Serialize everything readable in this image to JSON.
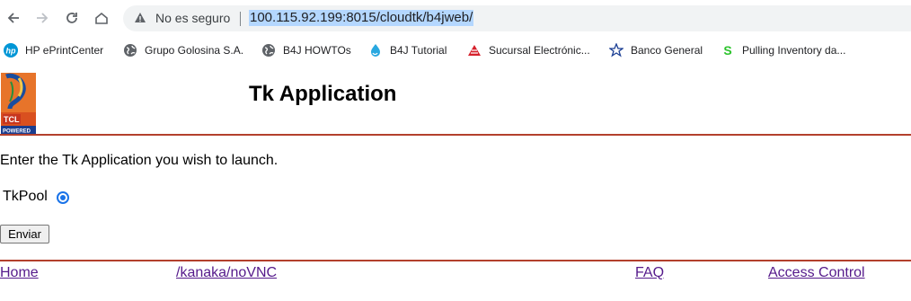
{
  "browser": {
    "security_label": "No es seguro",
    "url": "100.115.92.199:8015/cloudtk/b4jweb/"
  },
  "bookmarks": [
    {
      "label": "HP ePrintCenter",
      "icon": "hp-icon"
    },
    {
      "label": "Grupo Golosina S.A.",
      "icon": "globe-icon"
    },
    {
      "label": "B4J HOWTOs",
      "icon": "globe-icon"
    },
    {
      "label": "B4J Tutorial",
      "icon": "b4x-icon"
    },
    {
      "label": "Sucursal Electrónic...",
      "icon": "bank-icon"
    },
    {
      "label": "Banco General",
      "icon": "star-icon"
    },
    {
      "label": "Pulling Inventory da...",
      "icon": "s-icon"
    }
  ],
  "page": {
    "logo_text_top": "TCL",
    "logo_text_bottom": "POWERED",
    "title": "Tk Application",
    "intro": "Enter the Tk Application you wish to launch.",
    "option_label": "TkPool",
    "submit_label": "Enviar"
  },
  "footer": {
    "links": [
      "Home",
      "/kanaka/noVNC",
      "FAQ",
      "Access Control"
    ]
  },
  "colors": {
    "rule": "#b3402c",
    "link_visited": "#551a8b",
    "radio_accent": "#1a73e8"
  }
}
